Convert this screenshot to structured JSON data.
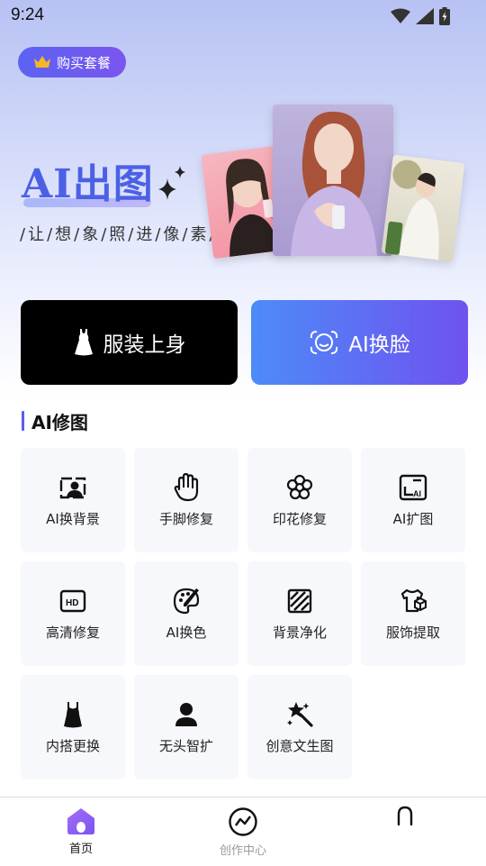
{
  "status_bar": {
    "time": "9:24"
  },
  "header": {
    "buy_label": "购买套餐"
  },
  "hero": {
    "title": "AI出图",
    "slogan": "/让/想/象/照/进/像/素/"
  },
  "actions": {
    "dress_label": "服装上身",
    "faceswap_label": "AI换脸"
  },
  "section": {
    "title": "AI修图"
  },
  "tools": [
    {
      "label": "AI换背景",
      "icon": "portrait-bg-icon"
    },
    {
      "label": "手脚修复",
      "icon": "hand-icon"
    },
    {
      "label": "印花修复",
      "icon": "flower-icon"
    },
    {
      "label": "AI扩图",
      "icon": "expand-ai-icon"
    },
    {
      "label": "高清修复",
      "icon": "hd-icon"
    },
    {
      "label": "AI换色",
      "icon": "palette-icon"
    },
    {
      "label": "背景净化",
      "icon": "hatch-square-icon"
    },
    {
      "label": "服饰提取",
      "icon": "shirt-box-icon"
    },
    {
      "label": "内搭更换",
      "icon": "tank-top-icon"
    },
    {
      "label": "无头智扩",
      "icon": "person-icon"
    },
    {
      "label": "创意文生图",
      "icon": "magic-wand-icon"
    }
  ],
  "nav": {
    "home_label": "首页",
    "create_label": "创作中心",
    "active_color": "#7b55ef",
    "inactive_color": "#9a9a9a"
  },
  "colors": {
    "accent": "#5b63f2",
    "accent2": "#7b55ef",
    "title_blue": "#4c60e6"
  }
}
